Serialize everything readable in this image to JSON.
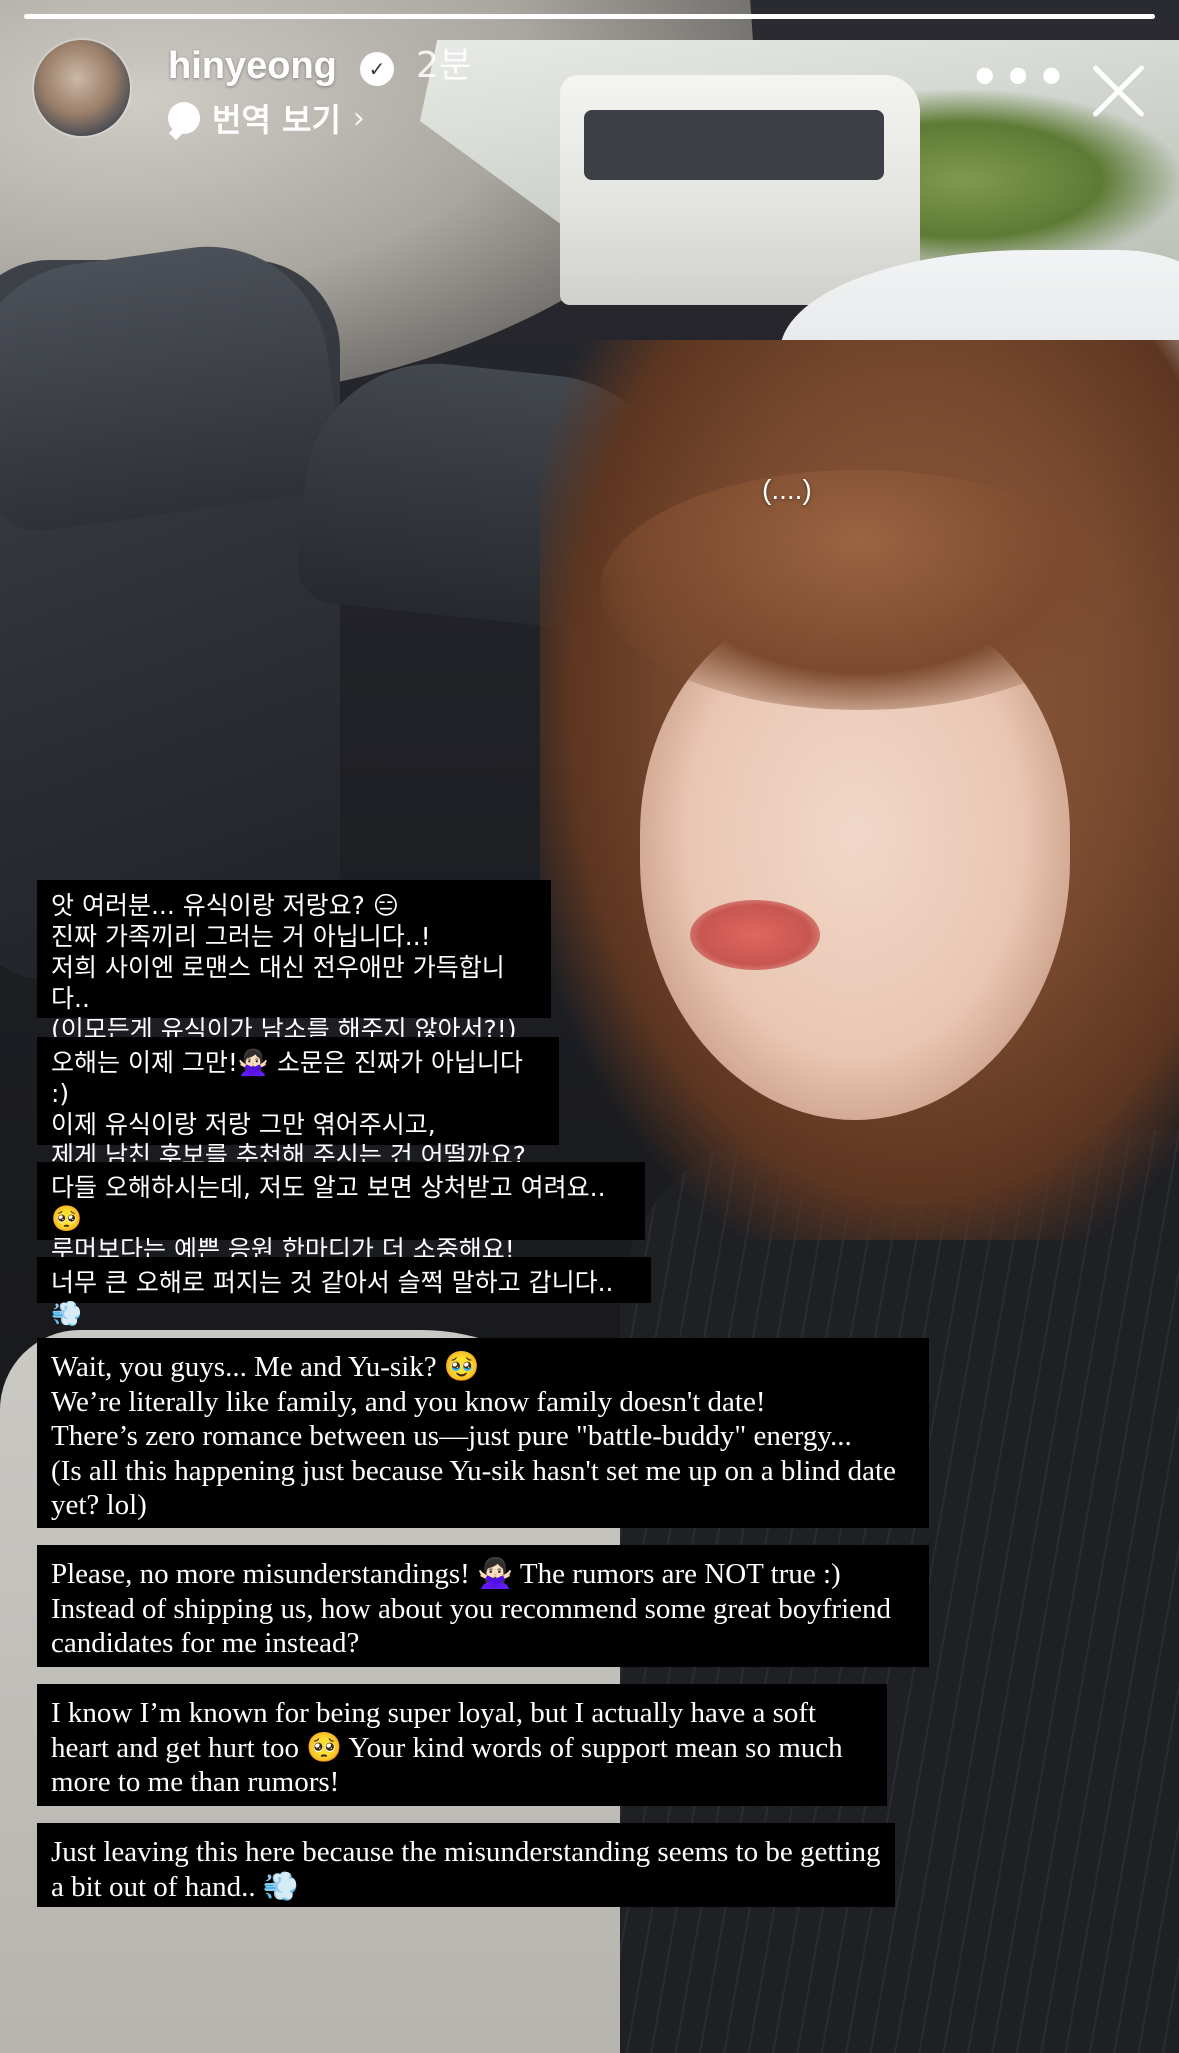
{
  "story": {
    "username": "hinyeong",
    "time_ago": "2분",
    "translate_label": "번역 보기",
    "progress": 1.0,
    "photo_note": "(....)"
  },
  "icons": {
    "verified": "verified-badge-icon",
    "translate": "speech-bubble-icon",
    "chevron": "chevron-right-icon",
    "more": "more-options-icon",
    "close": "close-icon"
  },
  "captions": {
    "ko": [
      "앗 여러분... 유식이랑 저랑요? 😑\n진짜 가족끼리 그러는 거 아닙니다..!\n저희 사이엔 로맨스 대신 전우애만 가득합니다..\n(이모든게 유식이가 남소를 해주지 않아서?!)",
      "오해는 이제 그만!🙅🏻‍♀️ 소문은 진짜가 아닙니다 :)\n이제 유식이랑 저랑 그만 엮어주시고,\n제게 남친 후보를 추천해 주시는 건 어떨까요?",
      "다들 오해하시는데, 저도 알고 보면 상처받고 여려요..🥺\n루머보다는 예쁜 응원 한마디가 더 소중해요!",
      "너무 큰 오해로 퍼지는 것 같아서 슬쩍 말하고 갑니다..💨"
    ],
    "en": [
      "Wait, you guys... Me and Yu-sik? 🥹\nWe’re literally like family, and you know family doesn't date!\nThere’s zero romance between us—just pure \"battle-buddy\" energy...\n(Is all this happening just because Yu-sik hasn't set me up on a blind date yet? lol)",
      "Please, no more misunderstandings! 🙅🏻‍♀️ The rumors are NOT true :)\nInstead of shipping us, how about you recommend some great boyfriend candidates for me instead?",
      "I know I’m known for being super loyal, but I actually have a soft heart and get hurt too 🥺 Your kind words of support mean so much more to me than rumors!",
      "Just leaving this here because the misunderstanding seems to be getting a bit out of hand.. 💨"
    ]
  }
}
